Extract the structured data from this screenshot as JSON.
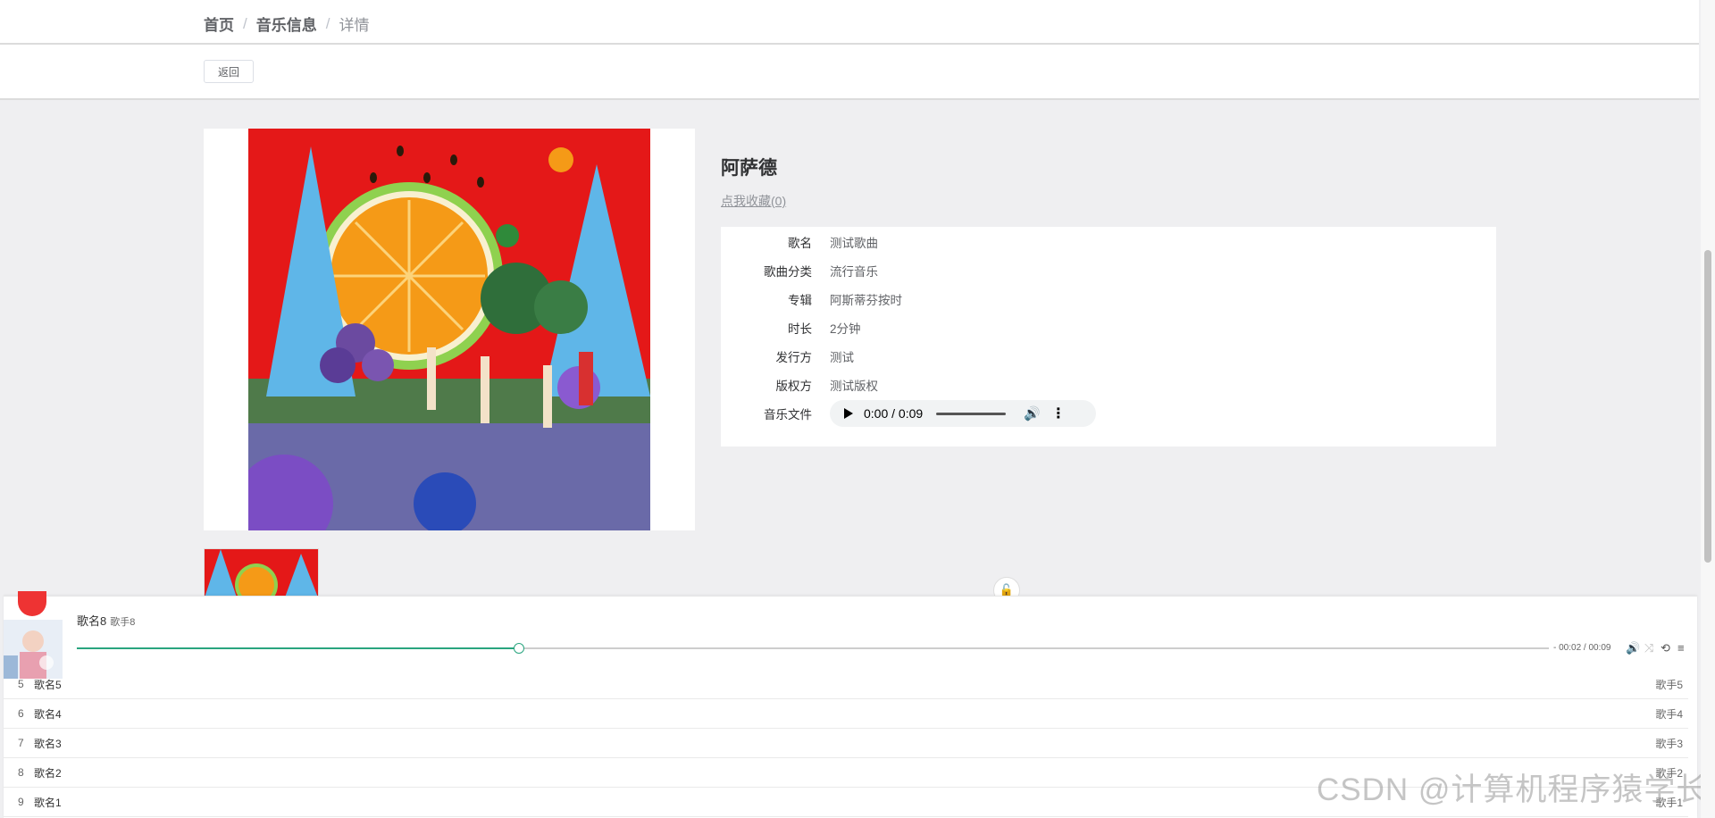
{
  "breadcrumb": {
    "home": "首页",
    "section": "音乐信息",
    "current": "详情",
    "separator": "/"
  },
  "toolbar": {
    "back_label": "返回"
  },
  "song": {
    "title": "阿萨德",
    "favorite_label": "点我收藏(0)",
    "details": [
      {
        "label": "歌名",
        "value": "测试歌曲"
      },
      {
        "label": "歌曲分类",
        "value": "流行音乐"
      },
      {
        "label": "专辑",
        "value": "阿斯蒂芬按时"
      },
      {
        "label": "时长",
        "value": "2分钟"
      },
      {
        "label": "发行方",
        "value": "测试"
      },
      {
        "label": "版权方",
        "value": "测试版权"
      }
    ],
    "file_label": "音乐文件",
    "audio_time": "0:00 / 0:09"
  },
  "player": {
    "title": "歌名8",
    "artist": "歌手8",
    "progress": 0.3,
    "time_text": "- 00:02 / 00:09",
    "accent_color": "#2aa57f",
    "playlist": [
      {
        "num": "5",
        "name": "歌名5",
        "artist": "歌手5"
      },
      {
        "num": "6",
        "name": "歌名4",
        "artist": "歌手4"
      },
      {
        "num": "7",
        "name": "歌名3",
        "artist": "歌手3"
      },
      {
        "num": "8",
        "name": "歌名2",
        "artist": "歌手2"
      },
      {
        "num": "9",
        "name": "歌名1",
        "artist": "歌手1"
      }
    ]
  },
  "watermark": "CSDN @计算机程序猿学长",
  "icons": {
    "play": "play-icon",
    "volume": "volume-icon",
    "more": "kebab-icon",
    "lock": "lock-icon",
    "shuffle": "shuffle-icon",
    "loop": "loop-icon",
    "menu": "menu-icon"
  }
}
